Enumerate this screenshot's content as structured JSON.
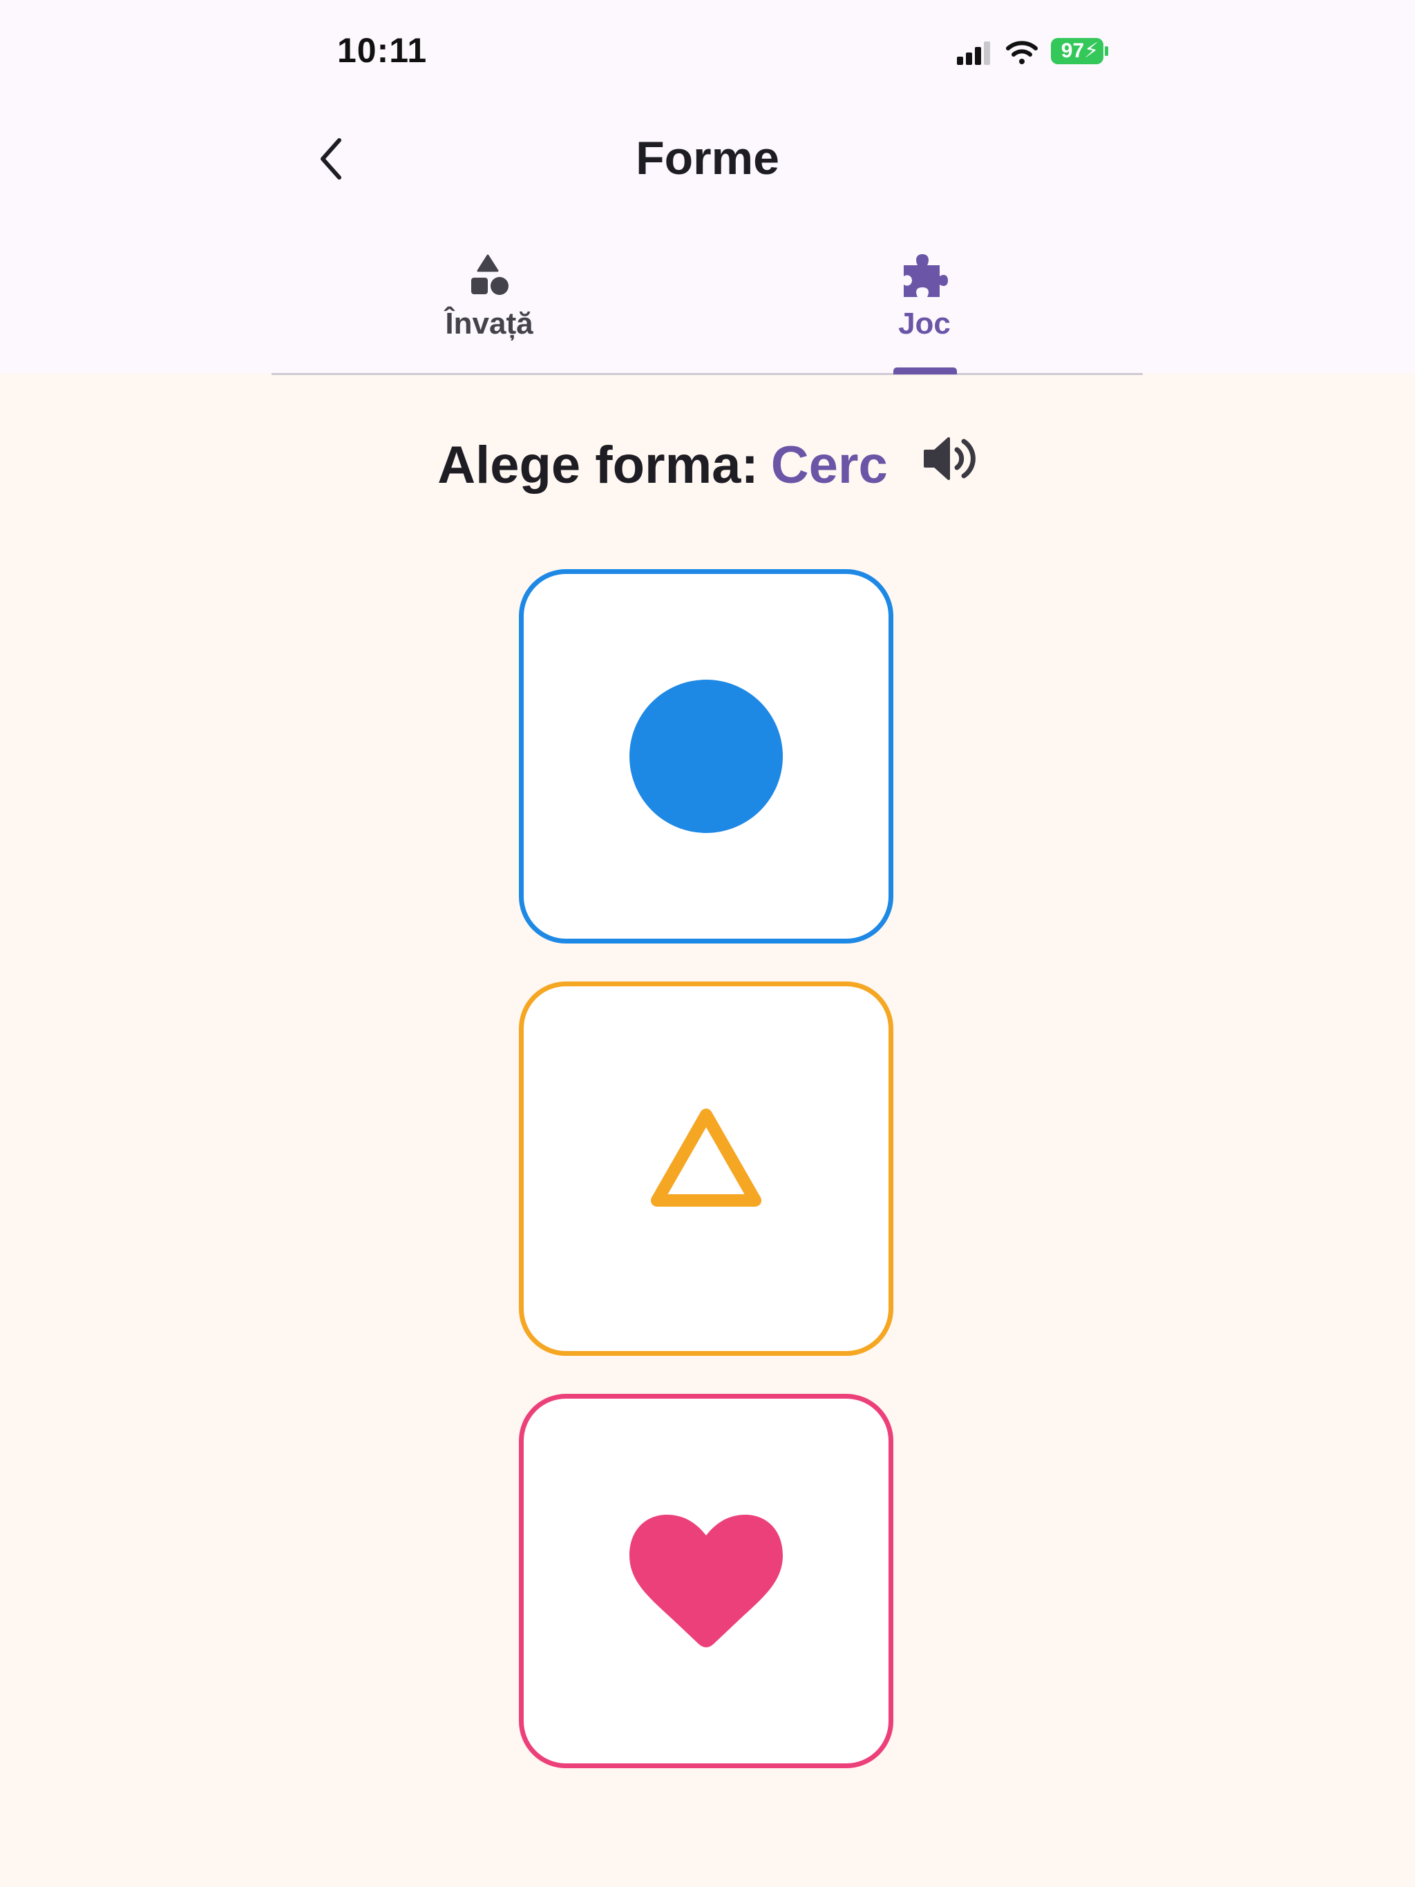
{
  "status_bar": {
    "time": "10:11",
    "battery": "97"
  },
  "header": {
    "title": "Forme",
    "back_icon": "chevron-left-icon"
  },
  "tabs": [
    {
      "label": "Învață",
      "icon": "shapes-icon",
      "selected": false
    },
    {
      "label": "Joc",
      "icon": "puzzle-icon",
      "selected": true
    }
  ],
  "game": {
    "prompt_label": "Alege forma:",
    "target_shape": "Cerc",
    "speaker_icon": "speaker-icon"
  },
  "choices": [
    {
      "shape": "circle",
      "icon": "circle-shape-icon",
      "color": "#1E88E5"
    },
    {
      "shape": "triangle",
      "icon": "triangle-shape-icon",
      "color": "#F5A623"
    },
    {
      "shape": "heart",
      "icon": "heart-shape-icon",
      "color": "#EC407A"
    }
  ],
  "colors": {
    "accent": "#6A55A6",
    "header_bg": "#FCF8FE",
    "page_bg": "#FFF8F2",
    "battery_green": "#34C759"
  }
}
